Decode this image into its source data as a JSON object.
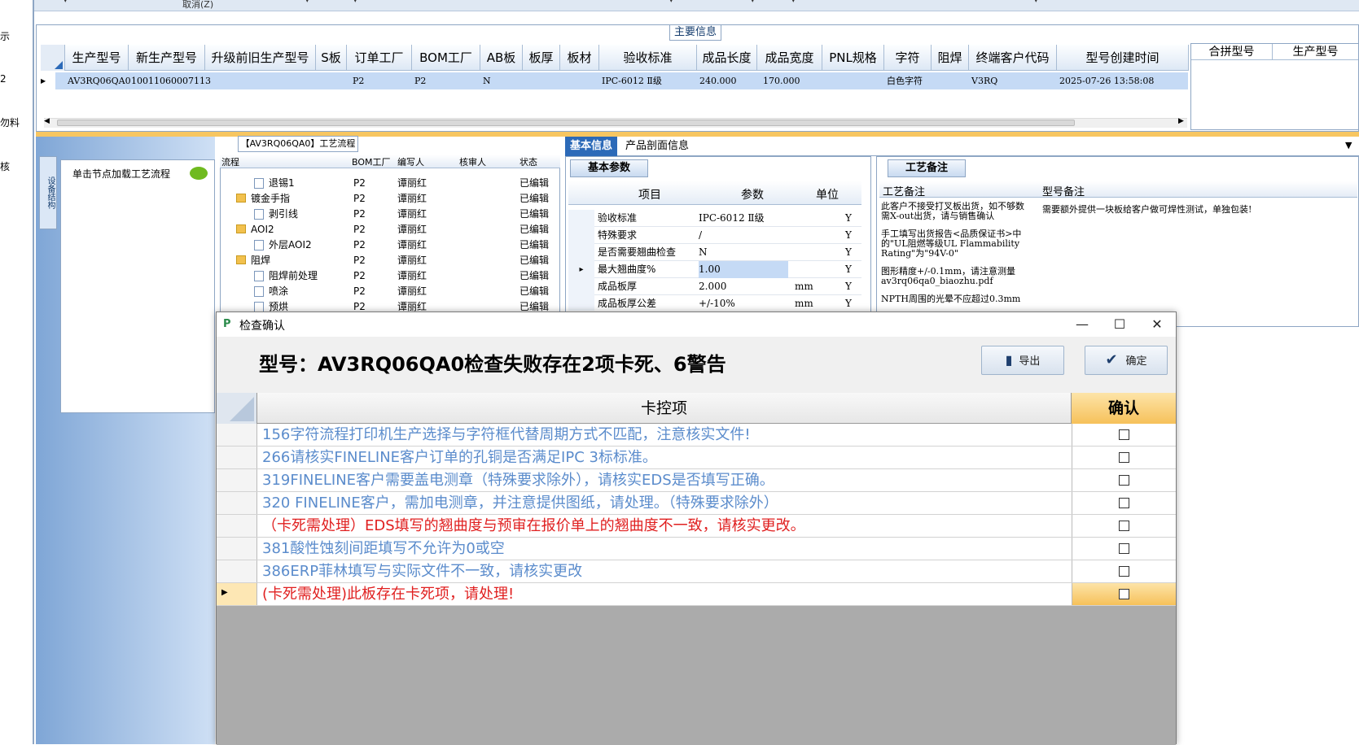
{
  "top_bar": {
    "cancel_label": "取消(Z)"
  },
  "left_strip": {
    "items": [
      "示",
      "2",
      "勿料",
      "核"
    ]
  },
  "main_info": {
    "title": "主要信息",
    "columns": [
      "生产型号",
      "新生产型号",
      "升级前旧生产型号",
      "S板",
      "订单工厂",
      "BOM工厂",
      "AB板",
      "板厚",
      "板材",
      "验收标准",
      "成品长度",
      "成品宽度",
      "PNL规格",
      "字符",
      "阻焊",
      "终端客户代码",
      "型号创建时间"
    ],
    "row": {
      "prod_no": "AV3RQ06QA0",
      "new_prod_no": "10011060007113",
      "order_factory": "P2",
      "bom_factory": "P2",
      "ab": "N",
      "standard": "IPC-6012 Ⅱ级",
      "length": "240.000",
      "width": "170.000",
      "char": "白色字符",
      "customer": "V3RQ",
      "created": "2025-07-26 13:58:08"
    },
    "right_columns": [
      "合拼型号",
      "生产型号"
    ]
  },
  "left_panel": {
    "vtab": "设备结构",
    "node_hint": "单击节点加载工艺流程"
  },
  "flow": {
    "title": "【AV3RQ06QA0】工艺流程",
    "columns": [
      "流程",
      "BOM工厂",
      "编写人",
      "核审人",
      "状态"
    ],
    "rows": [
      {
        "name": "退锡1",
        "bom": "P2",
        "writer": "谭丽红",
        "status": "已编辑",
        "type": "file",
        "indent": 1
      },
      {
        "name": "镀金手指",
        "bom": "P2",
        "writer": "谭丽红",
        "status": "已编辑",
        "type": "folder",
        "indent": 0
      },
      {
        "name": "剥引线",
        "bom": "P2",
        "writer": "谭丽红",
        "status": "已编辑",
        "type": "file",
        "indent": 1
      },
      {
        "name": "AOI2",
        "bom": "P2",
        "writer": "谭丽红",
        "status": "已编辑",
        "type": "folder",
        "indent": 0
      },
      {
        "name": "外层AOI2",
        "bom": "P2",
        "writer": "谭丽红",
        "status": "已编辑",
        "type": "file",
        "indent": 1
      },
      {
        "name": "阻焊",
        "bom": "P2",
        "writer": "谭丽红",
        "status": "已编辑",
        "type": "folder",
        "indent": 0
      },
      {
        "name": "阻焊前处理",
        "bom": "P2",
        "writer": "谭丽红",
        "status": "已编辑",
        "type": "file",
        "indent": 1
      },
      {
        "name": "喷涂",
        "bom": "P2",
        "writer": "谭丽红",
        "status": "已编辑",
        "type": "file",
        "indent": 1
      },
      {
        "name": "预烘",
        "bom": "P2",
        "writer": "谭丽红",
        "status": "已编辑",
        "type": "file",
        "indent": 1
      }
    ]
  },
  "info_tabs": {
    "basic": "基本信息",
    "profile": "产品剖面信息"
  },
  "basic_params": {
    "tab": "基本参数",
    "columns": [
      "项目",
      "参数",
      "单位"
    ],
    "rows": [
      {
        "item": "验收标准",
        "param": "IPC-6012 Ⅱ级",
        "unit": "",
        "flag": "Y"
      },
      {
        "item": "特殊要求",
        "param": "/",
        "unit": "",
        "flag": "Y"
      },
      {
        "item": "是否需要翘曲检查",
        "param": "N",
        "unit": "",
        "flag": "Y"
      },
      {
        "item": "最大翘曲度%",
        "param": "1.00",
        "unit": "",
        "flag": "Y"
      },
      {
        "item": "成品板厚",
        "param": "2.000",
        "unit": "mm",
        "flag": "Y"
      },
      {
        "item": "成品板厚公差",
        "param": "+/-10%",
        "unit": "mm",
        "flag": "Y"
      }
    ]
  },
  "craft": {
    "tab": "工艺备注",
    "col1": "工艺备注",
    "col2": "型号备注",
    "notes": [
      "此客户不接受打叉板出货，如不够数需X-out出货，请与销售确认",
      "手工填写出货报告<品质保证书>中的\"UL阻燃等级UL Flammability Rating\"为\"94V-0\"",
      "图形精度+/-0.1mm，请注意测量av3rq06qa0_biaozhu.pdf",
      "NPTH周围的光晕不应超过0.3mm"
    ],
    "model_note": "需要额外提供一块板给客户做可焊性测试，单独包装!"
  },
  "dialog": {
    "title": "检查确认",
    "heading": "型号：AV3RQ06QA0检查失败存在2项卡死、6警告",
    "export_label": "导出",
    "ok_label": "确定",
    "col_item": "卡控项",
    "col_confirm": "确认",
    "rows": [
      {
        "text": "156字符流程打印机生产选择与字符框代替周期方式不匹配，注意核实文件!",
        "level": "warn"
      },
      {
        "text": "266请核实FINELINE客户订单的孔铜是否满足IPC 3标标准。",
        "level": "warn"
      },
      {
        "text": "319FINELINE客户需要盖电测章（特殊要求除外），请核实EDS是否填写正确。",
        "level": "warn"
      },
      {
        "text": "320 FINELINE客户，需加电测章，并注意提供图纸，请处理。（特殊要求除外）",
        "level": "warn"
      },
      {
        "text": "（卡死需处理）EDS填写的翘曲度与预审在报价单上的翘曲度不一致，请核实更改。",
        "level": "block"
      },
      {
        "text": "381酸性蚀刻间距填写不允许为0或空",
        "level": "warn"
      },
      {
        "text": "386ERP菲林填写与实际文件不一致，请核实更改",
        "level": "warn"
      },
      {
        "text": "(卡死需处理)此板存在卡死项，请处理!",
        "level": "block"
      }
    ]
  },
  "colors": {
    "accent": "#2c6ab8",
    "warn_text": "#5b8ccc",
    "block_text": "#e02020",
    "confirm_header": "#f6c15a"
  }
}
